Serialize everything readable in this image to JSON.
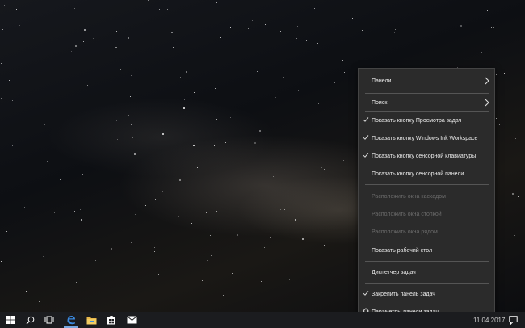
{
  "menu": {
    "items": [
      {
        "label": "Панели",
        "checked": false,
        "submenu": true,
        "disabled": false
      },
      {
        "label": "Поиск",
        "checked": false,
        "submenu": true,
        "disabled": false
      },
      {
        "label": "Показать кнопку Просмотра задач",
        "checked": true,
        "submenu": false,
        "disabled": false
      },
      {
        "label": "Показать кнопку Windows Ink Workspace",
        "checked": true,
        "submenu": false,
        "disabled": false
      },
      {
        "label": "Показать кнопку сенсорной клавиатуры",
        "checked": true,
        "submenu": false,
        "disabled": false
      },
      {
        "label": "Показать кнопку сенсорной панели",
        "checked": false,
        "submenu": false,
        "disabled": false
      },
      {
        "label": "Расположить окна каскадом",
        "checked": false,
        "submenu": false,
        "disabled": true
      },
      {
        "label": "Расположить окна стопкой",
        "checked": false,
        "submenu": false,
        "disabled": true
      },
      {
        "label": "Расположить окна рядом",
        "checked": false,
        "submenu": false,
        "disabled": true
      },
      {
        "label": "Показать рабочий стол",
        "checked": false,
        "submenu": false,
        "disabled": false
      },
      {
        "label": "Диспетчер задач",
        "checked": false,
        "submenu": false,
        "disabled": false
      },
      {
        "label": "Закрепить панель задач",
        "checked": true,
        "submenu": false,
        "disabled": false
      },
      {
        "label": "Параметры панели задач",
        "checked": false,
        "submenu": false,
        "disabled": false,
        "icon": "gear-icon"
      }
    ]
  },
  "taskbar": {
    "icons": [
      "windows-start-icon",
      "search-icon",
      "task-view-icon",
      "edge-browser-icon",
      "file-explorer-icon",
      "store-icon",
      "mail-icon"
    ],
    "clock": "11.04.2017",
    "accent": "#77a7e0"
  },
  "colors": {
    "menu_bg": "#2b2b2b",
    "taskbar_bg": "#1b1c1f"
  }
}
